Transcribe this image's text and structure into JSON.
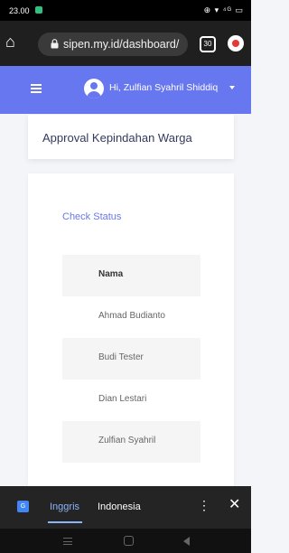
{
  "status_bar": {
    "time": "23.00",
    "right_indicators": "⊕ ▾ ⁴ᴳ ▭"
  },
  "browser": {
    "url": "sipen.my.id/dashboard/",
    "tab_count": "30"
  },
  "app_header": {
    "greeting": "Hi, Zulfian Syahril Shiddiq"
  },
  "page": {
    "title": "Approval Kepindahan Warga",
    "check_status_label": "Check Status",
    "table": {
      "header": "Nama",
      "rows": [
        "Ahmad Budianto",
        "Budi Tester",
        "Dian Lestari",
        "Zulfian Syahril"
      ]
    }
  },
  "translate_bar": {
    "tab_source": "Inggris",
    "tab_target": "Indonesia"
  },
  "colors": {
    "accent": "#6777ef",
    "browser_bar": "#1f1f1f",
    "translate_active": "#8ab4f8"
  }
}
